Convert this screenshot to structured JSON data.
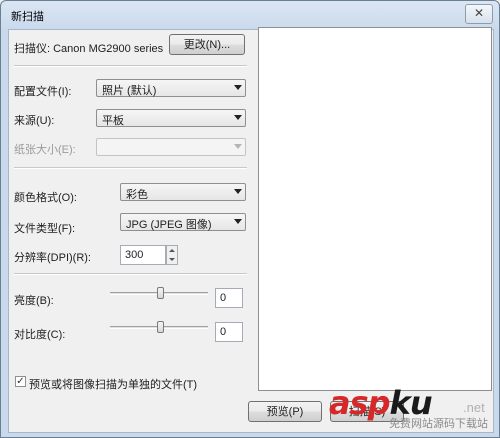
{
  "window": {
    "title": "新扫描",
    "close_glyph": "✕"
  },
  "scanner": {
    "label": "扫描仪: Canon MG2900 series",
    "change_button": "更改(N)..."
  },
  "profile": {
    "label": "配置文件(I):",
    "value": "照片 (默认)"
  },
  "source": {
    "label": "来源(U):",
    "value": "平板"
  },
  "paper_size": {
    "label": "纸张大小(E):",
    "value": ""
  },
  "color_format": {
    "label": "颜色格式(O):",
    "value": "彩色"
  },
  "file_type": {
    "label": "文件类型(F):",
    "value": "JPG (JPEG 图像)"
  },
  "resolution": {
    "label": "分辨率(DPI)(R):",
    "value": "300"
  },
  "brightness": {
    "label": "亮度(B):",
    "value": "0"
  },
  "contrast": {
    "label": "对比度(C):",
    "value": "0"
  },
  "separate_files": {
    "label": "预览或将图像扫描为单独的文件(T)",
    "checked": true,
    "check_glyph": "✓"
  },
  "buttons": {
    "preview": "预览(P)",
    "scan": "扫描(S)"
  },
  "watermark": {
    "brand_a": "asp",
    "brand_b": "ku",
    "sub": "免费网站源码下载站",
    "net": ".net"
  }
}
